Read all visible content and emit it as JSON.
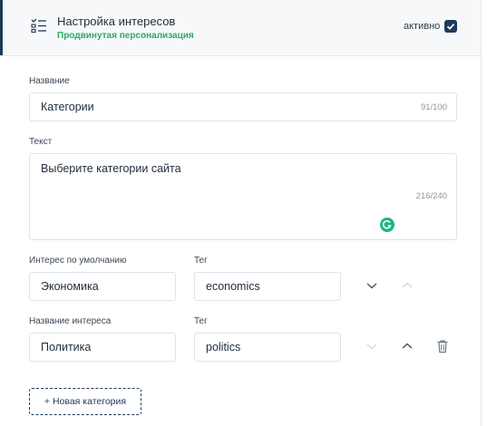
{
  "header": {
    "title": "Настройка интересов",
    "subtitle": "Продвинутая персонализация",
    "status_label": "активно",
    "status_checked": true,
    "accent_color": "#1e3a5a",
    "subtitle_color": "#2fa86a",
    "icon": "list-checks-icon"
  },
  "form": {
    "name_label": "Название",
    "name_value": "Категории",
    "name_counter": "91/100",
    "text_label": "Текст",
    "text_value": "Выберите категории сайта",
    "text_counter": "216/240",
    "default_interest_label": "Интерес по умолчанию",
    "tag_label_1": "Тег",
    "default_interest_value": "Экономика",
    "default_tag_value": "economics",
    "interest_name_label": "Название интереса",
    "tag_label_2": "Тег",
    "interest_name_value": "Политика",
    "interest_tag_value": "politics",
    "add_category_label": "+ Новая категория"
  }
}
